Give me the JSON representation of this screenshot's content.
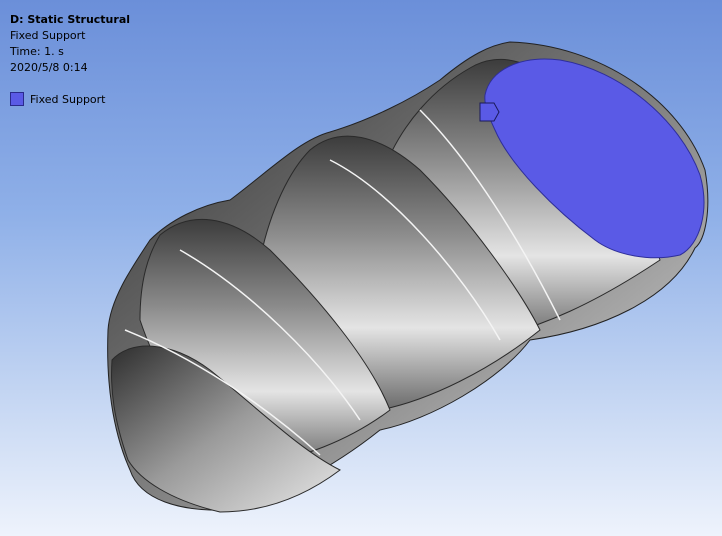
{
  "analysis": {
    "title": "D: Static Structural",
    "subtitle": "Fixed Support",
    "time": "Time: 1. s",
    "date": "2020/5/8 0:14"
  },
  "legend": {
    "label": "Fixed Support",
    "color": "#5a5ae6"
  },
  "colors": {
    "background_top": "#6b8fd9",
    "background_bottom": "#eef3fc",
    "support_face": "#5a5ae6",
    "body_dark": "#4a4a4a",
    "body_light": "#e0e0e0"
  }
}
